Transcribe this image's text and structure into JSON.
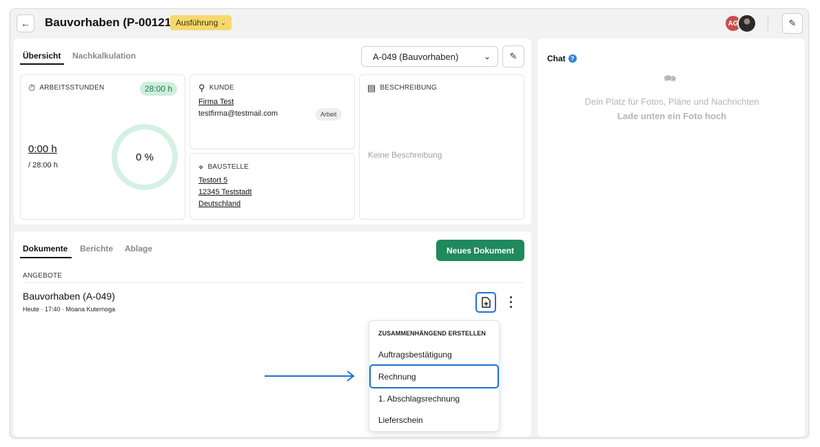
{
  "header": {
    "back_icon": "arrow-left-icon",
    "title": "Bauvorhaben (P-00121)",
    "status": "Ausführung",
    "avatar_initials": "AG",
    "edit_icon": "pencil-icon"
  },
  "overview": {
    "tabs": [
      {
        "label": "Übersicht",
        "active": true
      },
      {
        "label": "Nachkalkulation",
        "active": false
      }
    ],
    "selected_offer": "A-049 (Bauvorhaben)",
    "hours": {
      "label": "ARBEITSSTUNDEN",
      "badge": "28:00 h",
      "value": "0:00 h",
      "total": "/ 28:00 h",
      "percent_text": "0 %",
      "progress": 0
    },
    "customer": {
      "label": "KUNDE",
      "name": "Firma Test",
      "email": "testfirma@testmail.com",
      "tag": "Arbeit"
    },
    "site": {
      "label": "BAUSTELLE",
      "street": "Testort 5",
      "city": "12345 Teststadt",
      "country": "Deutschland"
    },
    "description": {
      "label": "BESCHREIBUNG",
      "empty_text": "Keine Beschreibung"
    }
  },
  "chat": {
    "title": "Chat",
    "empty_line1": "Dein Platz für Fotos, Pläne und Nachrichten",
    "empty_line2": "Lade unten ein Foto hoch"
  },
  "documents": {
    "tabs": [
      {
        "label": "Dokumente",
        "active": true
      },
      {
        "label": "Berichte",
        "active": false
      },
      {
        "label": "Ablage",
        "active": false
      }
    ],
    "new_button": "Neues Dokument",
    "section": "ANGEBOTE",
    "items": [
      {
        "title": "Bauvorhaben (A-049)",
        "meta": "Heute · 17:40 · Moana Kuternoga"
      }
    ]
  },
  "create_menu": {
    "heading": "ZUSAMMENHÄNGEND ERSTELLEN",
    "items": [
      "Auftragsbestätigung",
      "Rechnung",
      "1. Abschlagsrechnung",
      "Lieferschein"
    ],
    "highlighted": "Rechnung"
  },
  "colors": {
    "accent_blue": "#1f6fd6",
    "primary_green": "#1f8a5b",
    "status_yellow": "#f5d96e",
    "progress_ring": "#d5f1e3",
    "avatar_red": "#c94f4f"
  }
}
